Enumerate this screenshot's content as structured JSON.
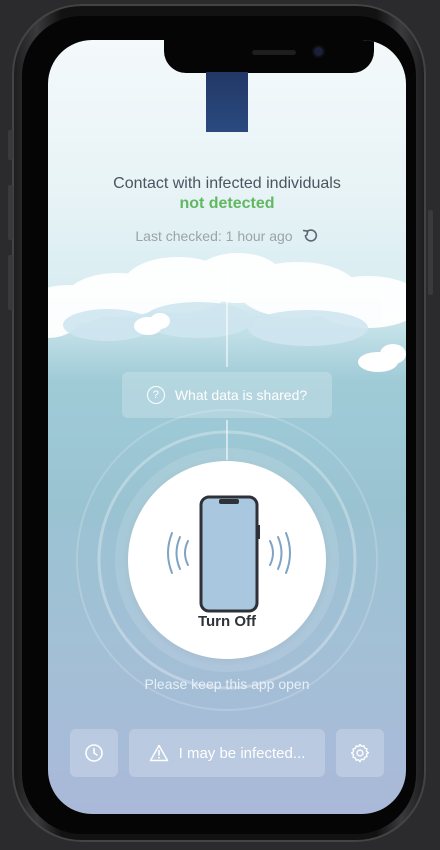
{
  "status": {
    "title": "Contact with infected individuals",
    "value": "not detected",
    "last_checked": "Last checked: 1 hour ago",
    "value_color": "#62b860"
  },
  "info_button": {
    "label": "What data is shared?",
    "icon": "question-circle-icon"
  },
  "main_toggle": {
    "label": "Turn Off",
    "icon": "phone-vibrate-icon"
  },
  "hint": "Please keep this app open",
  "bottom_bar": {
    "history_icon": "clock-icon",
    "infected_label": "I may be infected...",
    "infected_icon": "warning-triangle-icon",
    "settings_icon": "gear-icon"
  }
}
